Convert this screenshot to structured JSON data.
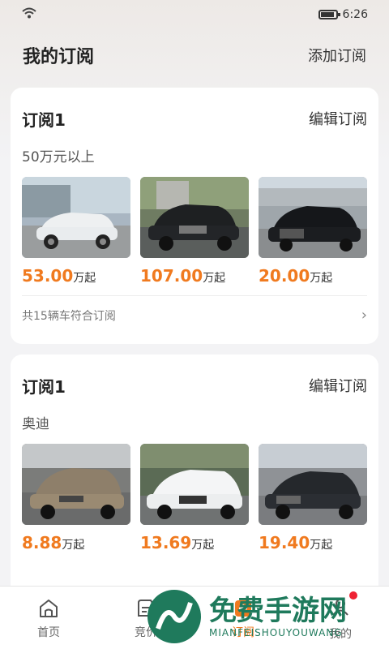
{
  "status": {
    "time": "6:26"
  },
  "header": {
    "title": "我的订阅",
    "add_label": "添加订阅"
  },
  "subscriptions": [
    {
      "title": "订阅1",
      "edit_label": "编辑订阅",
      "condition": "50万元以上",
      "cars": [
        {
          "price": "53.00",
          "unit": "万起"
        },
        {
          "price": "107.00",
          "unit": "万起"
        },
        {
          "price": "20.00",
          "unit": "万起"
        }
      ],
      "footer": "共15辆车符合订阅"
    },
    {
      "title": "订阅1",
      "edit_label": "编辑订阅",
      "condition": "奥迪",
      "cars": [
        {
          "price": "8.88",
          "unit": "万起"
        },
        {
          "price": "13.69",
          "unit": "万起"
        },
        {
          "price": "19.40",
          "unit": "万起"
        }
      ]
    }
  ],
  "tabs": [
    {
      "label": "首页",
      "icon": "home-icon"
    },
    {
      "label": "竞价",
      "icon": "auction-icon"
    },
    {
      "label": "订阅",
      "icon": "subscribe-icon"
    },
    {
      "label": "我的",
      "icon": "profile-icon"
    }
  ],
  "watermark": {
    "brand": "免费手游网",
    "domain": "MIANFEISHOUYOUWANG"
  },
  "colors": {
    "accent": "#f07a1f",
    "price": "#f07a1f",
    "background": "#f3f3f5"
  }
}
